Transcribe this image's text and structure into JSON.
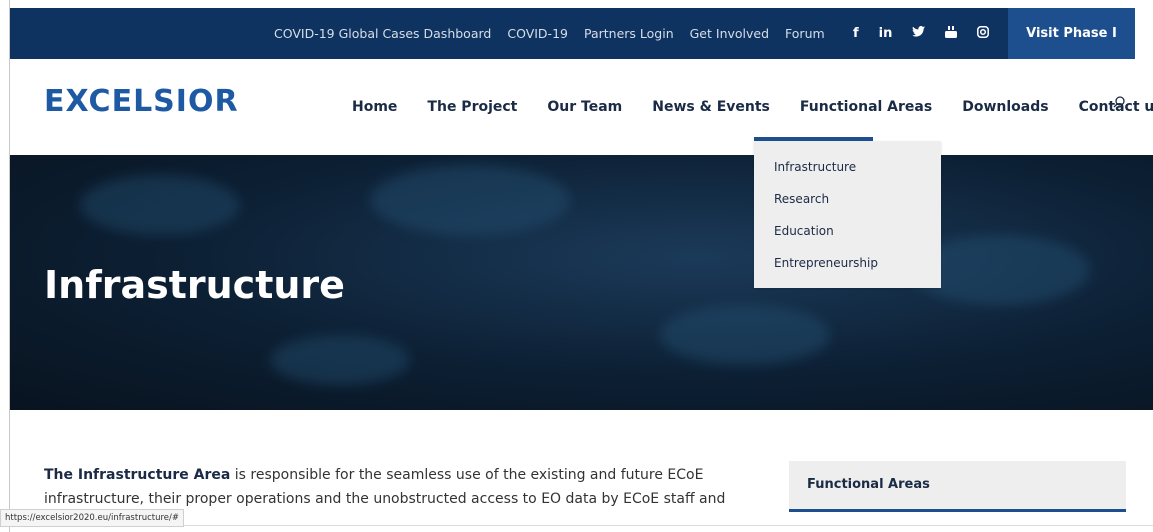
{
  "topbar": {
    "links": [
      "COVID-19 Global Cases Dashboard",
      "COVID-19",
      "Partners Login",
      "Get Involved",
      "Forum"
    ],
    "social_icons": [
      "f",
      "in",
      "☀",
      "▣",
      "◎"
    ],
    "visit_label": "Visit Phase I"
  },
  "header": {
    "logo_text": "EXCELSIOR",
    "nav": [
      "Home",
      "The Project",
      "Our Team",
      "News & Events",
      "Functional Areas",
      "Downloads",
      "Contact us"
    ]
  },
  "dropdown": {
    "items": [
      "Infrastructure",
      "Research",
      "Education",
      "Entrepreneurship"
    ]
  },
  "hero": {
    "title": "Infrastructure"
  },
  "content": {
    "lead_bold": "The Infrastructure Area",
    "lead_text": " is responsible for the seamless use of the existing and future ECoE",
    "line2": "infrastructure, their proper operations and the unobstructed access to EO data by ECoE staff and"
  },
  "sidebar": {
    "title": "Functional Areas"
  },
  "status_bar": {
    "url": "https://excelsior2020.eu/infrastructure/#"
  },
  "colors": {
    "topbar": "#0f3360",
    "accent": "#1d4f8f",
    "logo": "#1d5aa3"
  }
}
